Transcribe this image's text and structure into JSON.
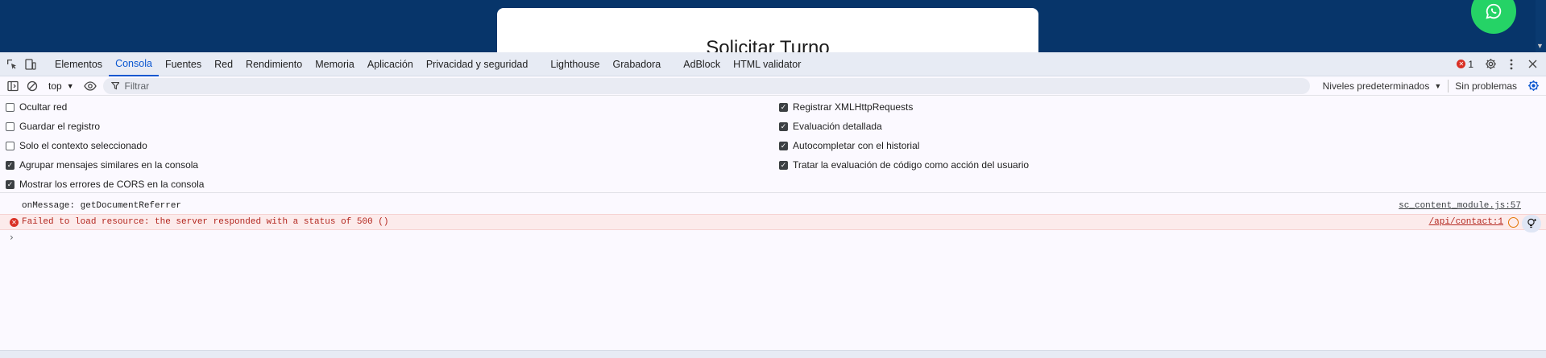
{
  "page": {
    "heading": "Solicitar Turno"
  },
  "tabs": [
    {
      "label": "Elementos"
    },
    {
      "label": "Consola"
    },
    {
      "label": "Fuentes"
    },
    {
      "label": "Red"
    },
    {
      "label": "Rendimiento"
    },
    {
      "label": "Memoria"
    },
    {
      "label": "Aplicación"
    },
    {
      "label": "Privacidad y seguridad"
    },
    {
      "label": "Lighthouse"
    },
    {
      "label": "Grabadora"
    },
    {
      "label": "AdBlock"
    },
    {
      "label": "HTML validator"
    }
  ],
  "active_tab": "Consola",
  "error_count": "1",
  "toolbar": {
    "context": "top",
    "filter_placeholder": "Filtrar",
    "levels": "Niveles predeterminados",
    "issues": "Sin problemas"
  },
  "settings": {
    "left": [
      {
        "label": "Ocultar red",
        "checked": false
      },
      {
        "label": "Guardar el registro",
        "checked": false
      },
      {
        "label": "Solo el contexto seleccionado",
        "checked": false
      },
      {
        "label": "Agrupar mensajes similares en la consola",
        "checked": true
      },
      {
        "label": "Mostrar los errores de CORS en la consola",
        "checked": true
      }
    ],
    "right": [
      {
        "label": "Registrar XMLHttpRequests",
        "checked": true
      },
      {
        "label": "Evaluación detallada",
        "checked": true
      },
      {
        "label": "Autocompletar con el historial",
        "checked": true
      },
      {
        "label": "Tratar la evaluación de código como acción del usuario",
        "checked": true
      }
    ]
  },
  "messages": [
    {
      "level": "info",
      "text": "onMessage: getDocumentReferrer",
      "source": "sc_content_module.js:57"
    },
    {
      "level": "error",
      "text": "Failed to load resource: the server responded with a status of 500 ()",
      "source": "/api/contact:1"
    }
  ],
  "colors": {
    "page_bg": "#07356a",
    "accent": "#0b57d0",
    "error": "#d93025",
    "whatsapp": "#25d366"
  }
}
